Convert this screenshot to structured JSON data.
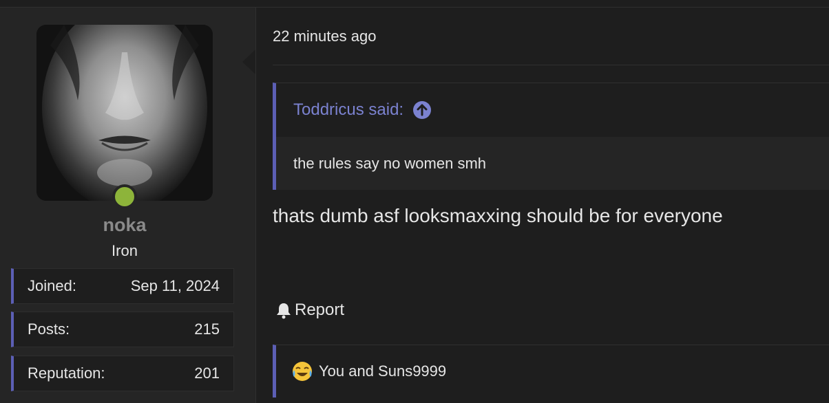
{
  "post": {
    "time": "22 minutes ago",
    "message": "thats dumb asf looksmaxxing should be for everyone",
    "report_label": "Report"
  },
  "user": {
    "name": "noka",
    "rank": "Iron",
    "online_color": "#8db43a",
    "stats": [
      {
        "label": "Joined:",
        "value": "Sep 11, 2024"
      },
      {
        "label": "Posts:",
        "value": "215"
      },
      {
        "label": "Reputation:",
        "value": "201"
      }
    ]
  },
  "quote": {
    "author": "Toddricus said:",
    "text": "the rules say no women smh",
    "icon": "arrow-up-circle-icon"
  },
  "reactions": {
    "emoji": "crying-laughing-emoji",
    "text": "You and Suns9999"
  },
  "colors": {
    "accent": "#5c5fb5",
    "quote_link": "#7b82d0",
    "background": "#1e1e1e",
    "sidebar": "#252525"
  }
}
